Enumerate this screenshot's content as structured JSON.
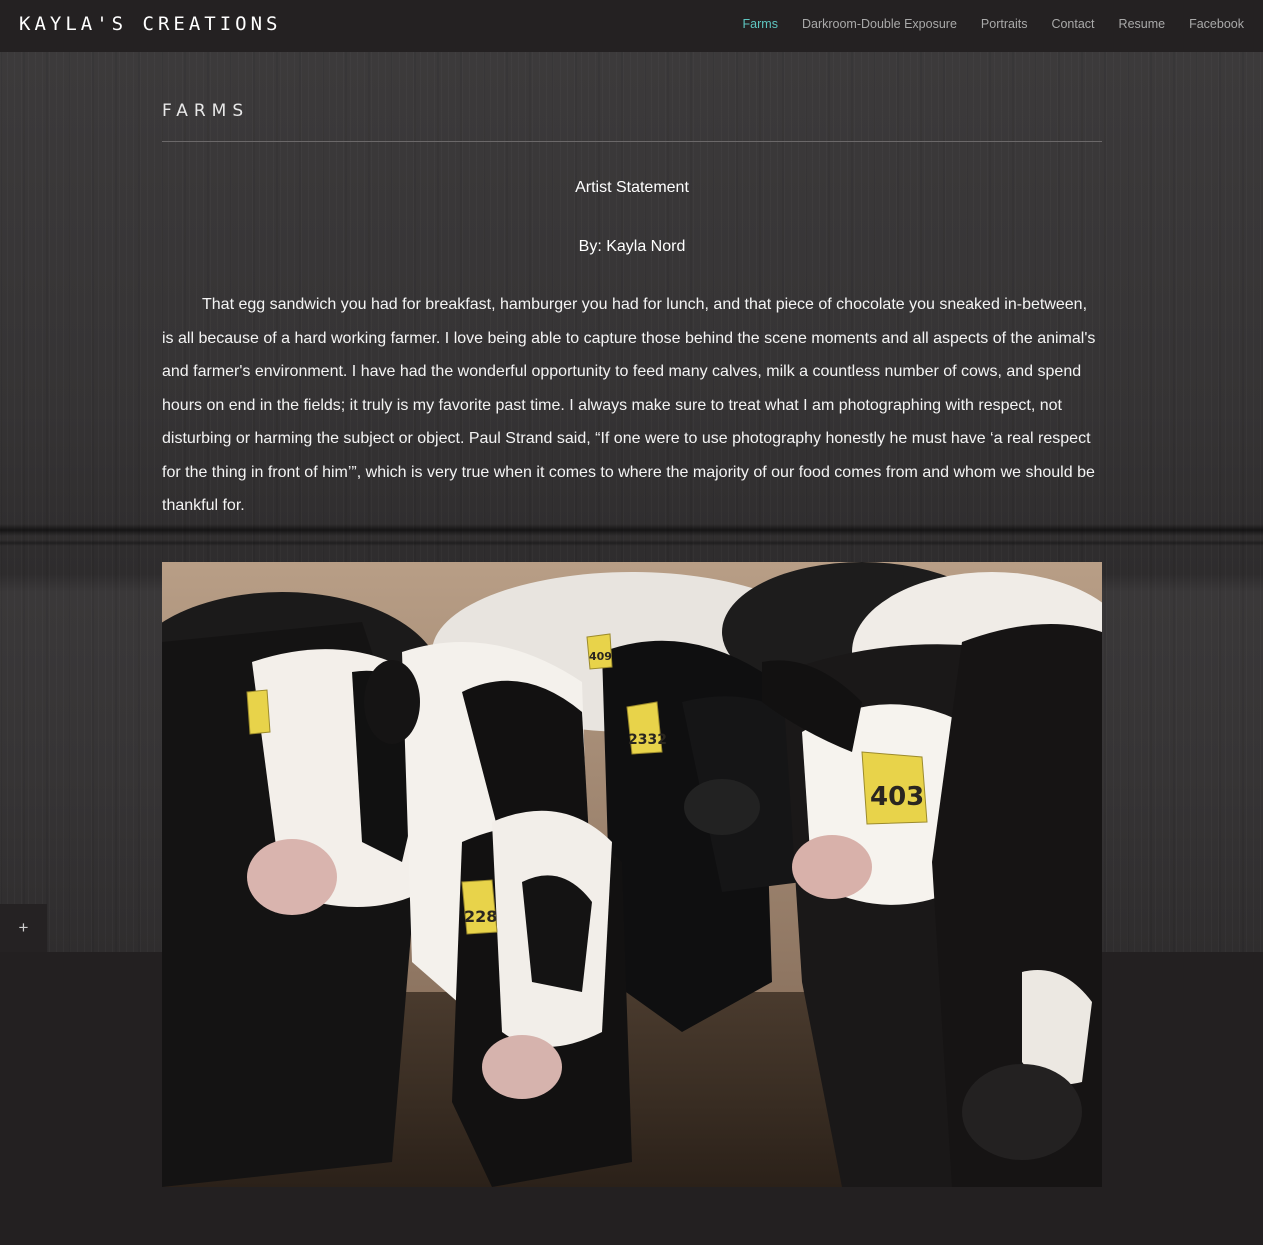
{
  "site": {
    "logo": "Kayla's Creations"
  },
  "nav": {
    "items": [
      {
        "label": "Farms",
        "active": true
      },
      {
        "label": "Darkroom-Double Exposure",
        "active": false
      },
      {
        "label": "Portraits",
        "active": false
      },
      {
        "label": "Contact",
        "active": false
      },
      {
        "label": "Resume",
        "active": false
      },
      {
        "label": "Facebook",
        "active": false
      }
    ],
    "active_color": "#5ec5c0"
  },
  "page": {
    "title": "FARMS",
    "statement_heading": "Artist Statement",
    "byline": "By: Kayla Nord",
    "body": "That egg sandwich you had for breakfast, hamburger you had for lunch, and that piece of chocolate you sneaked in-between, is all because of a hard working farmer. I love being able to capture those behind the scene moments and all aspects of the animal's and farmer's environment.  I have had the wonderful opportunity to feed many calves, milk a countless number of cows, and spend hours on end in the fields; it truly is my favorite past time. I always make sure to treat what I am photographing with respect, not disturbing or harming the subject or object. Paul Strand said, “If one were to use photography honestly he must have ‘a real respect for the thing in front of him’”, which is very true when it comes to where the majority of our food comes from and whom we should be thankful for."
  },
  "photo": {
    "subject": "herd of black and white dairy cows with yellow ear tags",
    "ear_tags": [
      "403",
      "2332",
      "228",
      "409"
    ]
  },
  "expand_tab": {
    "label": "+"
  }
}
